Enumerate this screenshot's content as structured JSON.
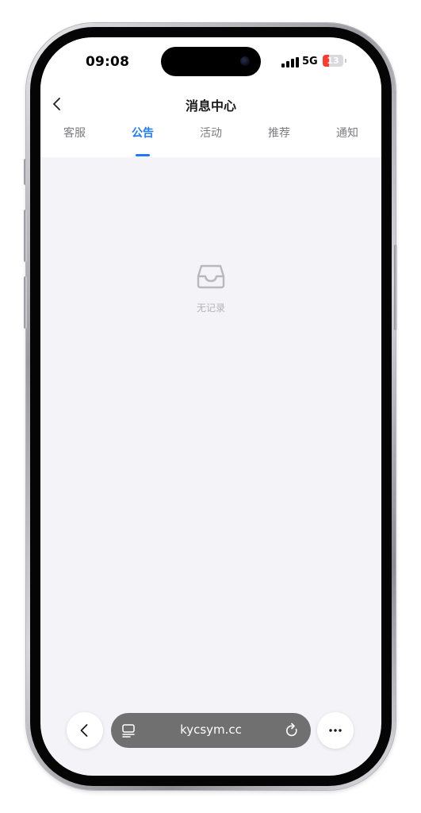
{
  "status_bar": {
    "time": "09:08",
    "network": "5G",
    "battery_level": "13",
    "battery_fraction": 0.13,
    "battery_color": "#ff3b30"
  },
  "header": {
    "title": "消息中心",
    "back_icon": "chevron-left-icon"
  },
  "tabs": [
    {
      "label": "客服",
      "active": false
    },
    {
      "label": "公告",
      "active": true
    },
    {
      "label": "活动",
      "active": false
    },
    {
      "label": "推荐",
      "active": false
    },
    {
      "label": "通知",
      "active": false
    }
  ],
  "empty_state": {
    "icon": "inbox-icon",
    "text": "无记录"
  },
  "browser_toolbar": {
    "url": "kycsym.cc",
    "back_icon": "chevron-left-icon",
    "tabs_icon": "tabs-icon",
    "reload_icon": "reload-icon",
    "more_icon": "ellipsis-icon"
  },
  "colors": {
    "accent": "#1e7bf5",
    "page_background": "#f3f3f8",
    "url_bar": "#707070"
  }
}
